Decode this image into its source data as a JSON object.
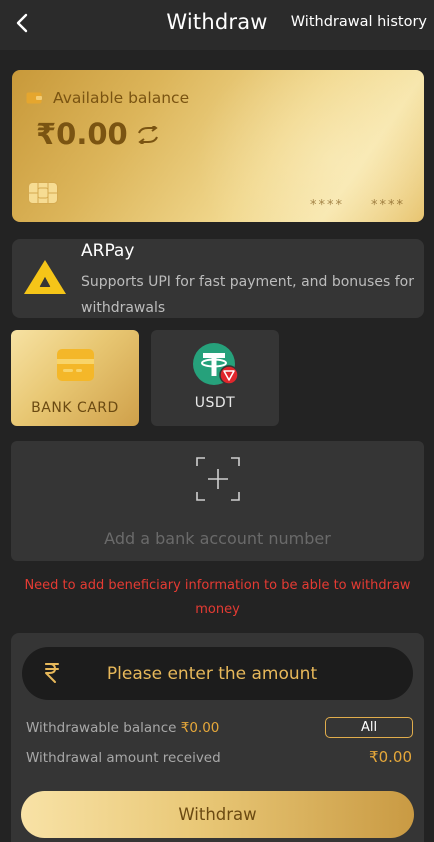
{
  "header": {
    "title": "Withdraw",
    "history_link": "Withdrawal history"
  },
  "balance_card": {
    "label": "Available balance",
    "amount": "₹0.00",
    "masked_left": "****",
    "masked_right": "****"
  },
  "arpay": {
    "title": "ARPay",
    "description": "Supports UPI for fast payment, and bonuses for withdrawals"
  },
  "methods": [
    {
      "label": "BANK CARD",
      "icon": "bank-card-icon",
      "selected": true
    },
    {
      "label": "USDT",
      "icon": "tether-icon",
      "selected": false
    }
  ],
  "add_bank": {
    "text": "Add a bank account number"
  },
  "warning": "Need to add beneficiary information to be able to withdraw money",
  "amount_panel": {
    "placeholder": "Please enter the amount",
    "withdrawable_label": "Withdrawable balance",
    "withdrawable_value": "₹0.00",
    "all_button": "All",
    "received_label": "Withdrawal amount received",
    "received_value": "₹0.00",
    "submit_button": "Withdraw"
  },
  "colors": {
    "background": "#232323",
    "panel": "#353535",
    "gold": "#e6a83a",
    "warning": "#e53b33"
  }
}
